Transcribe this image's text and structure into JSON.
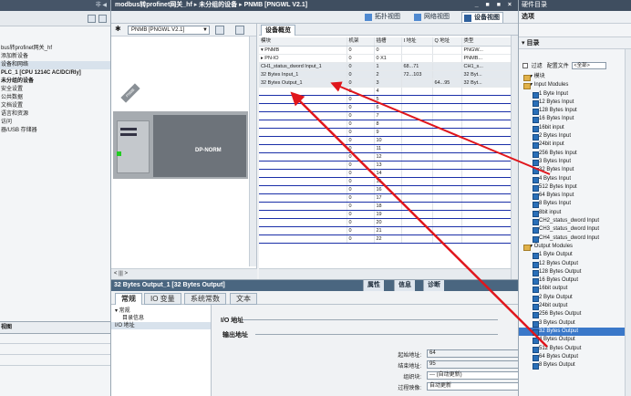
{
  "left": {
    "top_glyph": "非 ◀",
    "tree": [
      "bus转profinet网关_hf",
      "添加新设备",
      "设备和网络",
      "PLC_1 [CPU 1214C AC/DC/Rly]",
      "未分组的设备",
      "安全设置",
      "公共数据",
      "文档设置",
      "语言和资源",
      "访问",
      "器/USB 存储器"
    ],
    "details_view": "视图"
  },
  "middle": {
    "breadcrumb": "modbus转profinet网关_hf ▸ 未分组的设备 ▸ PNMB [PNGWL V2.1]",
    "window_controls": "_ ■ ■ ×",
    "view_tabs": [
      "拓扑视图",
      "网络视图",
      "设备视图"
    ],
    "device_select": "PNMB [PNGWL V2.1]",
    "device_label": "DP-NORM",
    "device_slant": "PNMB",
    "zoom": "< ||| >",
    "overview_tab": "设备概览",
    "table": {
      "headers": [
        "模块",
        "机架",
        "插槽",
        "I 地址",
        "Q 地址",
        "类型"
      ],
      "rows": [
        [
          "▾ PNMB",
          "0",
          "0",
          "",
          "",
          "PNGW..."
        ],
        [
          "▸ PN-IO",
          "0",
          "0 X1",
          "",
          "",
          "PNMB..."
        ],
        [
          "CH1_status_dword Input_1",
          "0",
          "1",
          "68...71",
          "",
          "CH1_s..."
        ],
        [
          "32 Bytes Input_1",
          "0",
          "2",
          "72...103",
          "",
          "32 Byt..."
        ],
        [
          "32 Bytes Output_1",
          "0",
          "3",
          "",
          "64...95",
          "32 Byt..."
        ],
        [
          "",
          "0",
          "4",
          "",
          "",
          ""
        ],
        [
          "",
          "0",
          "5",
          "",
          "",
          ""
        ],
        [
          "",
          "0",
          "6",
          "",
          "",
          ""
        ],
        [
          "",
          "0",
          "7",
          "",
          "",
          ""
        ],
        [
          "",
          "0",
          "8",
          "",
          "",
          ""
        ],
        [
          "",
          "0",
          "9",
          "",
          "",
          ""
        ],
        [
          "",
          "0",
          "10",
          "",
          "",
          ""
        ],
        [
          "",
          "0",
          "11",
          "",
          "",
          ""
        ],
        [
          "",
          "0",
          "12",
          "",
          "",
          ""
        ],
        [
          "",
          "0",
          "13",
          "",
          "",
          ""
        ],
        [
          "",
          "0",
          "14",
          "",
          "",
          ""
        ],
        [
          "",
          "0",
          "15",
          "",
          "",
          ""
        ],
        [
          "",
          "0",
          "16",
          "",
          "",
          ""
        ],
        [
          "",
          "0",
          "17",
          "",
          "",
          ""
        ],
        [
          "",
          "0",
          "18",
          "",
          "",
          ""
        ],
        [
          "",
          "0",
          "19",
          "",
          "",
          ""
        ],
        [
          "",
          "0",
          "20",
          "",
          "",
          ""
        ],
        [
          "",
          "0",
          "21",
          "",
          "",
          ""
        ],
        [
          "",
          "0",
          "22",
          "",
          "",
          ""
        ]
      ]
    },
    "props": {
      "title": "32 Bytes Output_1 [32 Bytes Output]",
      "hdr_tabs": [
        "属性",
        "信息",
        "诊断"
      ],
      "tabs": [
        "常规",
        "IO 变量",
        "系统常数",
        "文本"
      ],
      "nav": [
        "▾ 常规",
        "目录信息",
        "I/O 地址"
      ],
      "section": "I/O 地址",
      "subsection": "输出地址",
      "fields": [
        {
          "label": "起始地址:",
          "value": "64"
        },
        {
          "label": "结束地址:",
          "value": "95"
        },
        {
          "label": "组织块:",
          "value": "--- (自动更新)"
        },
        {
          "label": "过程映像:",
          "value": "自动更新"
        }
      ]
    }
  },
  "right": {
    "panel_title": "硬件目录",
    "options": "选项",
    "catalog": "▾ 目录",
    "filter_label": "过滤",
    "profile_label": "配置文件",
    "profile_value": "<全部>",
    "items": [
      {
        "t": "grp",
        "label": "▾ 模块"
      },
      {
        "t": "grp",
        "label": "▾ Input Modules"
      },
      {
        "t": "item",
        "label": "1 Byte Input"
      },
      {
        "t": "item",
        "label": "12 Bytes Input"
      },
      {
        "t": "item",
        "label": "128 Bytes Input"
      },
      {
        "t": "item",
        "label": "16 Bytes Input"
      },
      {
        "t": "item",
        "label": "16bit input"
      },
      {
        "t": "item",
        "label": "2 Bytes Input"
      },
      {
        "t": "item",
        "label": "24bit input"
      },
      {
        "t": "item",
        "label": "256 Bytes Input"
      },
      {
        "t": "item",
        "label": "3 Bytes Input"
      },
      {
        "t": "item",
        "label": "32 Bytes Input"
      },
      {
        "t": "item",
        "label": "4 Bytes Input"
      },
      {
        "t": "item",
        "label": "512 Bytes Input"
      },
      {
        "t": "item",
        "label": "64 Bytes Input"
      },
      {
        "t": "item",
        "label": "8 Bytes Input"
      },
      {
        "t": "item",
        "label": "8bit input"
      },
      {
        "t": "item",
        "label": "CH2_status_dword Input"
      },
      {
        "t": "item",
        "label": "CH3_status_dword Input"
      },
      {
        "t": "item",
        "label": "CH4_status_dword Input"
      },
      {
        "t": "grp",
        "label": "▾ Output Modules"
      },
      {
        "t": "item",
        "label": "1 Byte Output"
      },
      {
        "t": "item",
        "label": "12 Bytes Output"
      },
      {
        "t": "item",
        "label": "128 Bytes Output"
      },
      {
        "t": "item",
        "label": "16 Bytes Output"
      },
      {
        "t": "item",
        "label": "16bit output"
      },
      {
        "t": "item",
        "label": "2 Byte Output"
      },
      {
        "t": "item",
        "label": "24bit output"
      },
      {
        "t": "item",
        "label": "256 Bytes Output"
      },
      {
        "t": "item",
        "label": "3 Bytes Output"
      },
      {
        "t": "item",
        "label": "32 Bytes Output",
        "sel": true
      },
      {
        "t": "item",
        "label": "4 Bytes Output"
      },
      {
        "t": "item",
        "label": "512 Bytes Output"
      },
      {
        "t": "item",
        "label": "64 Bytes Output"
      },
      {
        "t": "item",
        "label": "8 Bytes Output"
      }
    ]
  },
  "colors": {
    "arrow": "#e0161c",
    "selected": "#3a78c9",
    "grid_line": "#1a2fa8"
  }
}
